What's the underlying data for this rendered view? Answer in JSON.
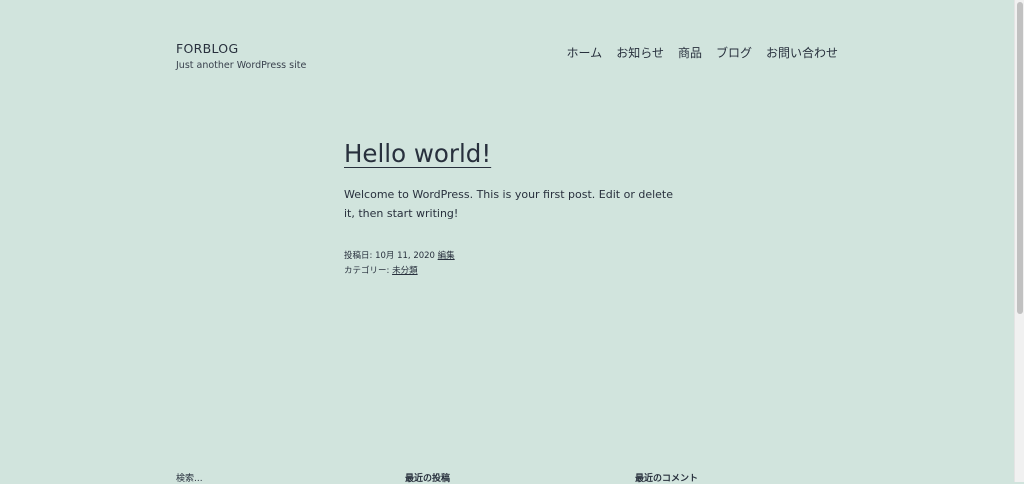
{
  "site": {
    "title": "FORBLOG",
    "tagline": "Just another WordPress site"
  },
  "nav": {
    "items": [
      {
        "label": "ホーム"
      },
      {
        "label": "お知らせ"
      },
      {
        "label": "商品"
      },
      {
        "label": "ブログ"
      },
      {
        "label": "お問い合わせ"
      }
    ]
  },
  "post": {
    "title": "Hello world!",
    "content": "Welcome to WordPress. This is your first post. Edit or delete it, then start writing!",
    "meta": {
      "posted_label": "投稿日:",
      "date": "10月 11, 2020",
      "edit_label": "編集",
      "category_label": "カテゴリー:",
      "category": "未分類"
    }
  },
  "footer": {
    "search_label": "検索...",
    "recent_posts_heading": "最近の投稿",
    "recent_comments_heading": "最近のコメント"
  },
  "colors": {
    "background": "#d1e4dd",
    "text": "#28303d"
  }
}
